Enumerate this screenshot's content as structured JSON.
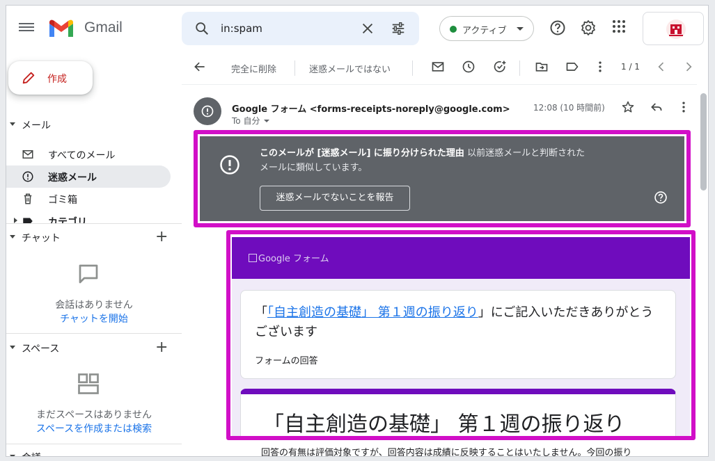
{
  "header": {
    "app_name": "Gmail",
    "search_query": "in:spam",
    "status_label": "アクティブ",
    "status_color": "#1e8e3e"
  },
  "sidebar": {
    "compose_label": "作成",
    "mail_section": "メール",
    "items": [
      {
        "label": "すべてのメール",
        "icon": "mail-icon"
      },
      {
        "label": "迷惑メール",
        "icon": "spam-icon",
        "active": true
      },
      {
        "label": "ゴミ箱",
        "icon": "trash-icon"
      },
      {
        "label": "カテゴリ",
        "icon": "label-icon"
      }
    ],
    "chat_section": "チャット",
    "chat_empty": "会話はありません",
    "chat_link": "チャットを開始",
    "spaces_section": "スペース",
    "spaces_empty": "まだスペースはありません",
    "spaces_link": "スペースを作成または検索",
    "meet_section": "会議"
  },
  "toolbar": {
    "delete_forever": "完全に削除",
    "not_spam": "迷惑メールではない",
    "pager": "1 / 1"
  },
  "message": {
    "sender": "Google フォーム <forms-receipts-noreply@google.com>",
    "to": "To 自分",
    "time": "12:08 (10 時間前)"
  },
  "spam_warning": {
    "title": "このメールが [迷惑メール] に振り分けられた理由",
    "reason": "以前迷惑メールと判断されたメールに類似しています。",
    "report_button": "迷惑メールでないことを報告"
  },
  "email_body": {
    "header_image_alt": "Google フォーム",
    "thanks_prefix": "「",
    "form_link": "「自主創造の基礎」 第１週の振り返り",
    "thanks_suffix": "」にご記入いただきありがとうございます",
    "responses_label": "フォームの回答",
    "form_title": "「自主創造の基礎」 第１週の振り返り",
    "note": "回答の有無は評価対象ですが、回答内容は成績に反映することはいたしません。今回の振り"
  },
  "colors": {
    "highlight": "#d10fc7",
    "form_accent": "#6f0cbd",
    "warning_bg": "#5f6368"
  }
}
